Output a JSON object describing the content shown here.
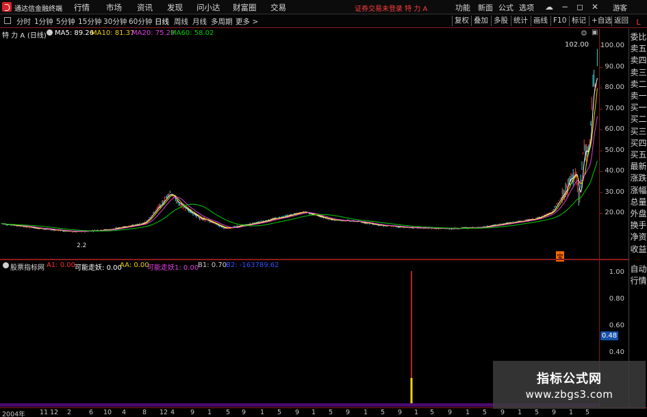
{
  "app": {
    "title": "通达信金融终端"
  },
  "menu": [
    "行情",
    "市场",
    "资讯",
    "发现",
    "问小达",
    "财富圈",
    "交易"
  ],
  "login_status": "证券交易未登录  特 力 A",
  "top_right_menu": [
    "功能",
    "新面",
    "公式",
    "选项"
  ],
  "guest_label": "游客",
  "periods": [
    "分时",
    "1分钟",
    "5分钟",
    "15分钟",
    "30分钟",
    "60分钟",
    "日线",
    "周线",
    "月线",
    "多周期",
    "更多 >"
  ],
  "active_period": "日线",
  "toolbar": [
    "复权",
    "叠加",
    "多股",
    "统计",
    "画线",
    "F10",
    "标记",
    "+自选",
    "返回"
  ],
  "stock": {
    "name": "特 力 A",
    "period_tag": "(日线)"
  },
  "ma_legend": [
    {
      "label": "MA5:",
      "value": "89.26",
      "color": "#ffffff"
    },
    {
      "label": "MA10:",
      "value": "81.37",
      "color": "#f2d300"
    },
    {
      "label": "MA20:",
      "value": "75.29",
      "color": "#e040e0"
    },
    {
      "label": "MA60:",
      "value": "58.02",
      "color": "#00d000"
    }
  ],
  "main_axis": [
    "100.00",
    "90.00",
    "80.00",
    "70.00",
    "60.00",
    "50.00",
    "40.00",
    "30.00",
    "20.00"
  ],
  "price_high_label": "102.00",
  "indicator": {
    "name": "股票指标网",
    "items": [
      {
        "label": "A1:",
        "value": "0.00",
        "color": "#ff3030"
      },
      {
        "label": "可能走妖:",
        "value": "0.00",
        "color": "#ffffff"
      },
      {
        "label": "AA:",
        "value": "0.00",
        "color": "#f2d300"
      },
      {
        "label": "可能走妖1:",
        "value": "0.00",
        "color": "#e040e0"
      },
      {
        "label": "B1:",
        "value": "0.70",
        "color": "#d0d0d0"
      },
      {
        "label": "B2:",
        "value": "-163789.62",
        "color": "#3050ff"
      }
    ]
  },
  "sub_axis": [
    "1.00",
    "0.80",
    "0.60",
    "0.40"
  ],
  "sub_axis_highlight": "0.48",
  "sidebar": [
    "委比",
    "卖五",
    "卖四",
    "卖三",
    "卖二",
    "卖一",
    "买一",
    "买二",
    "买三",
    "买四",
    "买五",
    "最新",
    "涨跌",
    "涨幅",
    "总量",
    "外盘",
    "换手",
    "净资",
    "收益",
    "自动",
    "行情"
  ],
  "sidebar_top": "L",
  "time_axis": [
    "2004年",
    "11",
    "12",
    "2",
    "6",
    "10",
    "4",
    "8",
    "12",
    "4",
    "9",
    "1",
    "5",
    "9",
    "1",
    "5",
    "9",
    "1",
    "5",
    "9",
    "1",
    "5",
    "9",
    "1",
    "5",
    "9",
    "1",
    "5",
    "9",
    "1",
    "5",
    "9",
    "1",
    "5"
  ],
  "markers": {
    "low_mark": "2.2",
    "event_mark": "宝"
  },
  "watermark": {
    "title": "指标公式网",
    "url": "www.zbgs3.com"
  },
  "colors": {
    "divider": "#8b1a1a",
    "signal": "#ff2a2a",
    "signal_base": "#f2d300",
    "scroll": "#4a0b6e"
  }
}
